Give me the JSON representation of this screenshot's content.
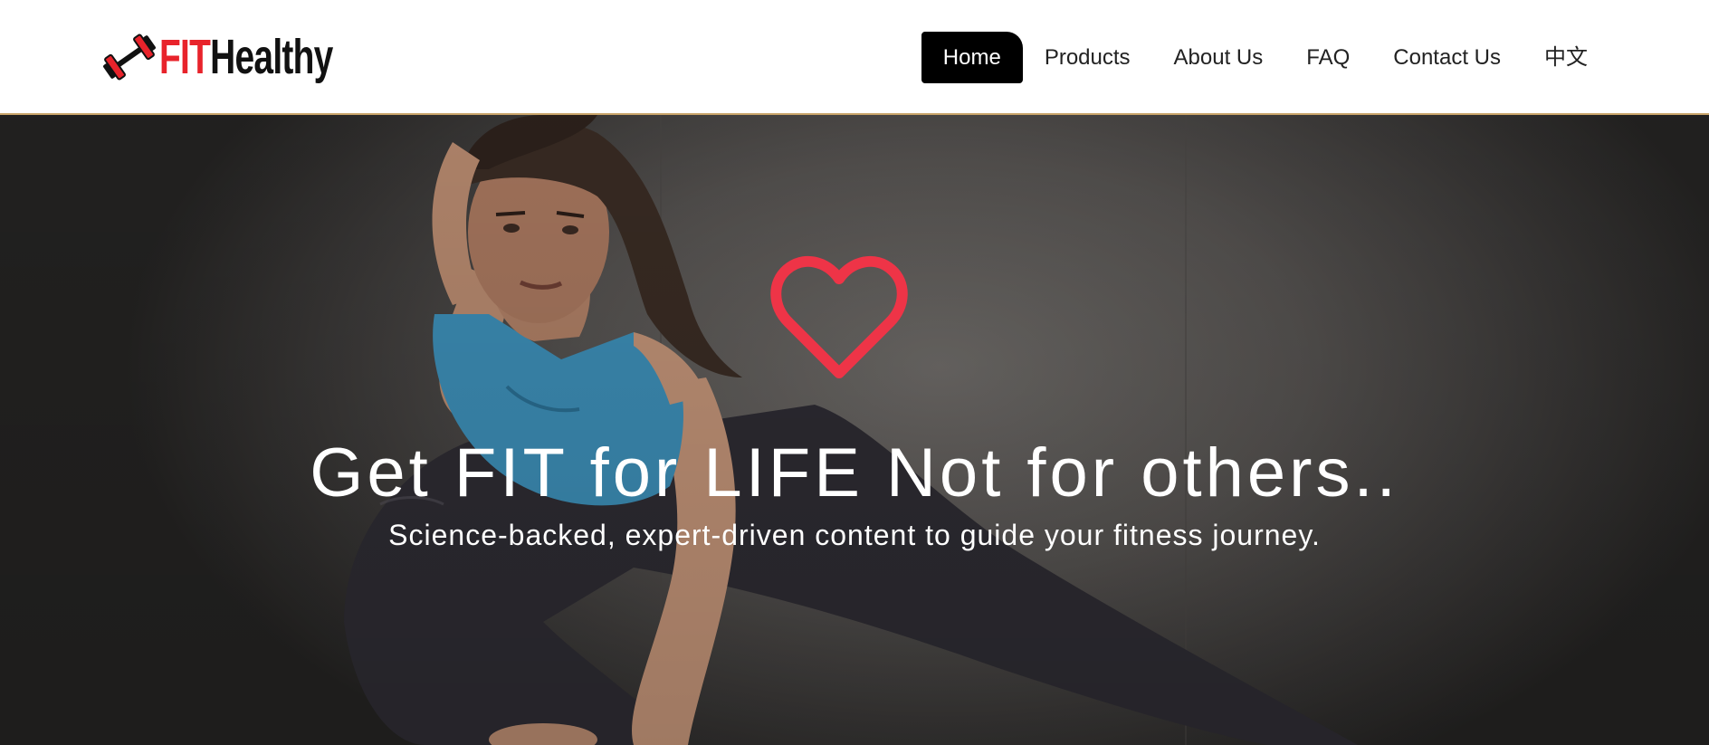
{
  "header": {
    "logo": {
      "fit_text": "FIT",
      "healthy_text": "Healthy",
      "icon": "dumbbell-icon"
    },
    "nav": [
      {
        "label": "Home",
        "active": true
      },
      {
        "label": "Products",
        "active": false
      },
      {
        "label": "About Us",
        "active": false
      },
      {
        "label": "FAQ",
        "active": false
      },
      {
        "label": "Contact Us",
        "active": false
      },
      {
        "label": "中文",
        "active": false
      }
    ]
  },
  "hero": {
    "icon": "heart-icon",
    "title": "Get FIT for LIFE Not for others..",
    "subtitle": "Science-backed, expert-driven content to guide your fitness journey."
  },
  "colors": {
    "brand_red": "#e8232b",
    "heart_red": "#ee3447",
    "nav_active_bg": "#000000",
    "header_border": "#c9a46a"
  }
}
